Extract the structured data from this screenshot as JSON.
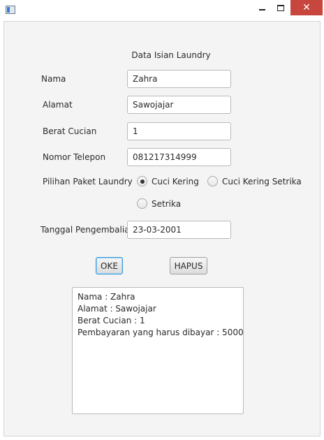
{
  "window": {
    "close_glyph": "✕"
  },
  "form": {
    "heading": "Data Isian Laundry",
    "nama": {
      "label": "Nama",
      "value": "Zahra"
    },
    "alamat": {
      "label": "Alamat",
      "value": "Sawojajar"
    },
    "berat": {
      "label": "Berat Cucian",
      "value": "1"
    },
    "telepon": {
      "label": "Nomor Telepon",
      "value": "081217314999"
    },
    "paket": {
      "label": "Pilihan Paket Laundry",
      "options": [
        {
          "label": "Cuci Kering",
          "selected": true
        },
        {
          "label": "Cuci Kering Setrika",
          "selected": false
        },
        {
          "label": "Setrika",
          "selected": false
        }
      ]
    },
    "tanggal": {
      "label": "Tanggal Pengembalian",
      "value": "23-03-2001"
    }
  },
  "buttons": {
    "ok": "OKE",
    "hapus": "HAPUS"
  },
  "output": {
    "lines": [
      "Nama : Zahra",
      "Alamat : Sawojajar",
      "Berat Cucian : 1",
      "Pembayaran yang harus dibayar : 5000"
    ]
  }
}
